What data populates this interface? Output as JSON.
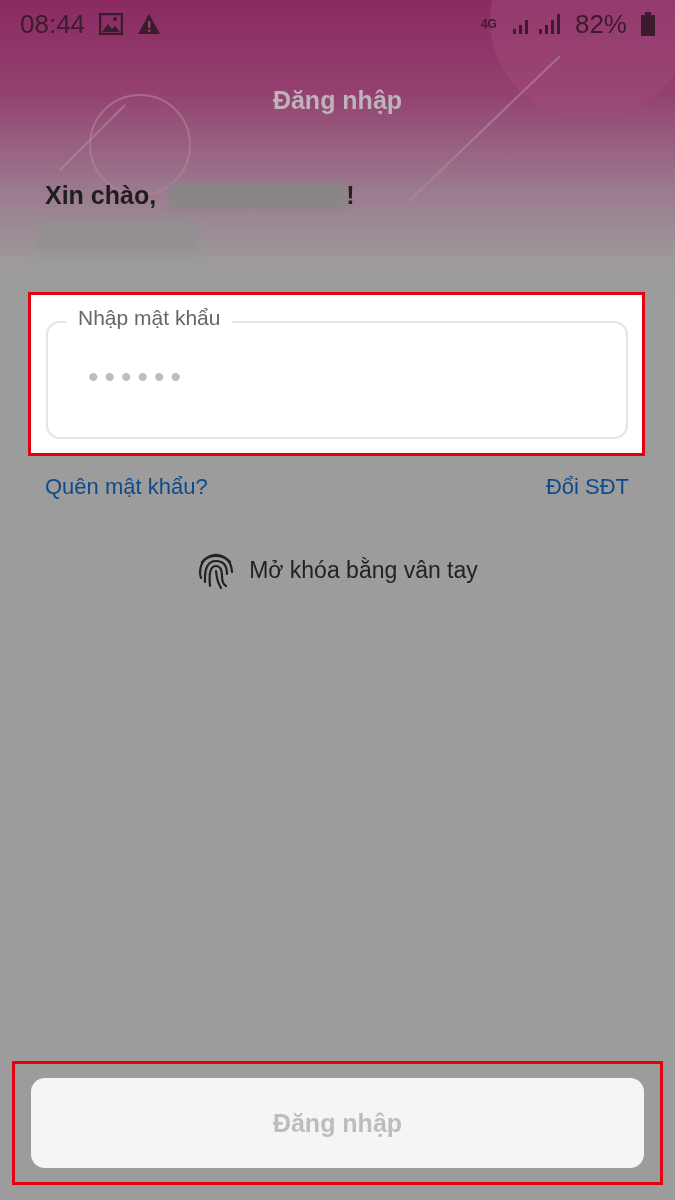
{
  "status_bar": {
    "time": "08:44",
    "network": "4G",
    "battery": "82%"
  },
  "header": {
    "title": "Đăng nhập"
  },
  "greeting": {
    "prefix": "Xin chào,",
    "suffix": "!"
  },
  "password_field": {
    "label": "Nhập mật khẩu",
    "value": "••••••"
  },
  "links": [
    {
      "label": "Quên mật khẩu?"
    },
    {
      "label": "Đổi SĐT"
    }
  ],
  "fingerprint": {
    "label": "Mở khóa bằng vân tay"
  },
  "login_button": {
    "label": "Đăng nhập",
    "disabled": true
  }
}
